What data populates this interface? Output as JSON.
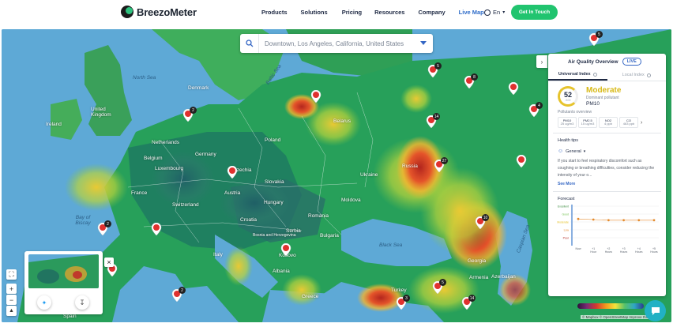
{
  "nav": {
    "brand": "BreezoMeter",
    "items": [
      "Products",
      "Solutions",
      "Pricing",
      "Resources",
      "Company",
      "Live Map"
    ],
    "lang": "En",
    "cta": "Get In Touch"
  },
  "search": {
    "value": "Downtown, Los Angeles, California, United States"
  },
  "map_labels": {
    "seas": [
      "North Sea",
      "Baltic Sea",
      "Bay of Biscay",
      "Black Sea",
      "Caspian Sea"
    ],
    "countries": [
      "Denmark",
      "Ireland",
      "United Kingdom",
      "Netherlands",
      "Belgium",
      "Luxembourg",
      "Germany",
      "Poland",
      "Belarus",
      "Czechia",
      "Slovakia",
      "Austria",
      "Switzerland",
      "France",
      "Hungary",
      "Romania",
      "Ukraine",
      "Russia",
      "Bulgaria",
      "Serbia",
      "Moldova",
      "Croatia",
      "Bosnia and Herzegovina",
      "Italy",
      "Spain",
      "Greece",
      "Turkey",
      "Georgia",
      "Azerbaijan",
      "Armenia",
      "Albania",
      "Kosovo"
    ],
    "cluster_counts": [
      "5",
      "2",
      "5",
      "14",
      "8",
      "4",
      "27",
      "10",
      "2",
      "2",
      "3",
      "5",
      "14"
    ]
  },
  "panel": {
    "title": "Air Quality Overview",
    "live": "LIVE",
    "tabs": [
      "Universal Index",
      "Local Index"
    ],
    "aqi": {
      "value": "52",
      "scale": "/100",
      "category": "Moderate",
      "dominant_label": "Dominant pollutant",
      "dominant": "PM10"
    },
    "pollutants_label": "Pollutants overview",
    "pollutants": [
      {
        "name": "PM10",
        "value": "25 ug/m3"
      },
      {
        "name": "PM2.5",
        "value": "15 ug/m3"
      },
      {
        "name": "NO2",
        "value": "4 ppb"
      },
      {
        "name": "CO",
        "value": "463 ppb"
      }
    ],
    "health_title": "Health tips",
    "health_dropdown": "General",
    "health_tip": "If you start to feel respiratory discomfort such as coughing or breathing difficulties, consider reducing the intensity of your o...",
    "see_more": "See More",
    "forecast_title": "Forecast",
    "forecast_levels": [
      "Excellent",
      "Good",
      "Moderate",
      "Low",
      "Poor"
    ],
    "forecast_x": [
      "Now",
      "+1 Hour",
      "+2 Hours",
      "+3 Hours",
      "+4 Hours",
      "+5 Hours"
    ],
    "forecast_values": [
      52,
      50,
      48,
      48,
      48,
      48
    ]
  },
  "attribution": "© Mapbox © OpenStreetMap Improve this map",
  "colors": {
    "accent": "#21c46f",
    "link": "#3466c4",
    "moderate": "#d8b916"
  }
}
